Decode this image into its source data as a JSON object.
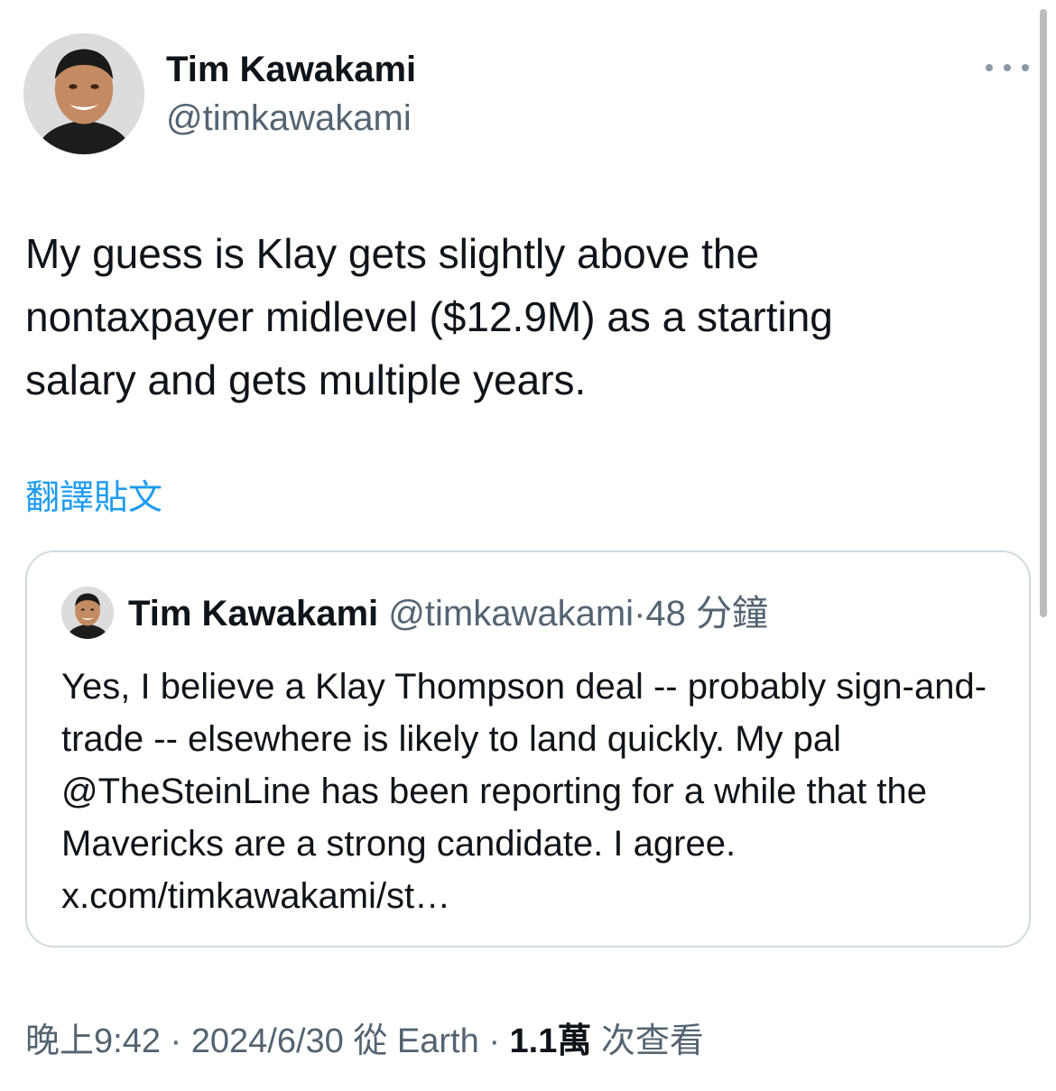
{
  "author": {
    "display_name": "Tim Kawakami",
    "handle": "@timkawakami"
  },
  "icons": {
    "more": "more-horizontal-icon",
    "avatar": "avatar-photo"
  },
  "tweet": {
    "text": "My guess is Klay gets slightly above the nontaxpayer midlevel ($12.9M) as a starting salary and gets multiple years.",
    "translate_label": "翻譯貼文"
  },
  "quoted_tweet": {
    "display_name": "Tim Kawakami",
    "handle": "@timkawakami",
    "separator": "·",
    "time": "48 分鐘",
    "text": "Yes, I believe a Klay Thompson deal -- probably sign-and-trade -- elsewhere is likely to land quickly. My pal @TheSteinLine has been reporting for a while that the Mavericks are a strong candidate. I agree. x.com/timkawakami/st…"
  },
  "meta": {
    "time": "晚上9:42",
    "sep1": " · ",
    "date": "2024/6/30",
    "source": " 從 Earth",
    "sep2": " · ",
    "views_count": "1.1萬",
    "views_label": " 次查看"
  },
  "colors": {
    "text": "#0f1419",
    "secondary": "#536471",
    "link": "#1d9bf0",
    "border": "#cfd9de"
  }
}
